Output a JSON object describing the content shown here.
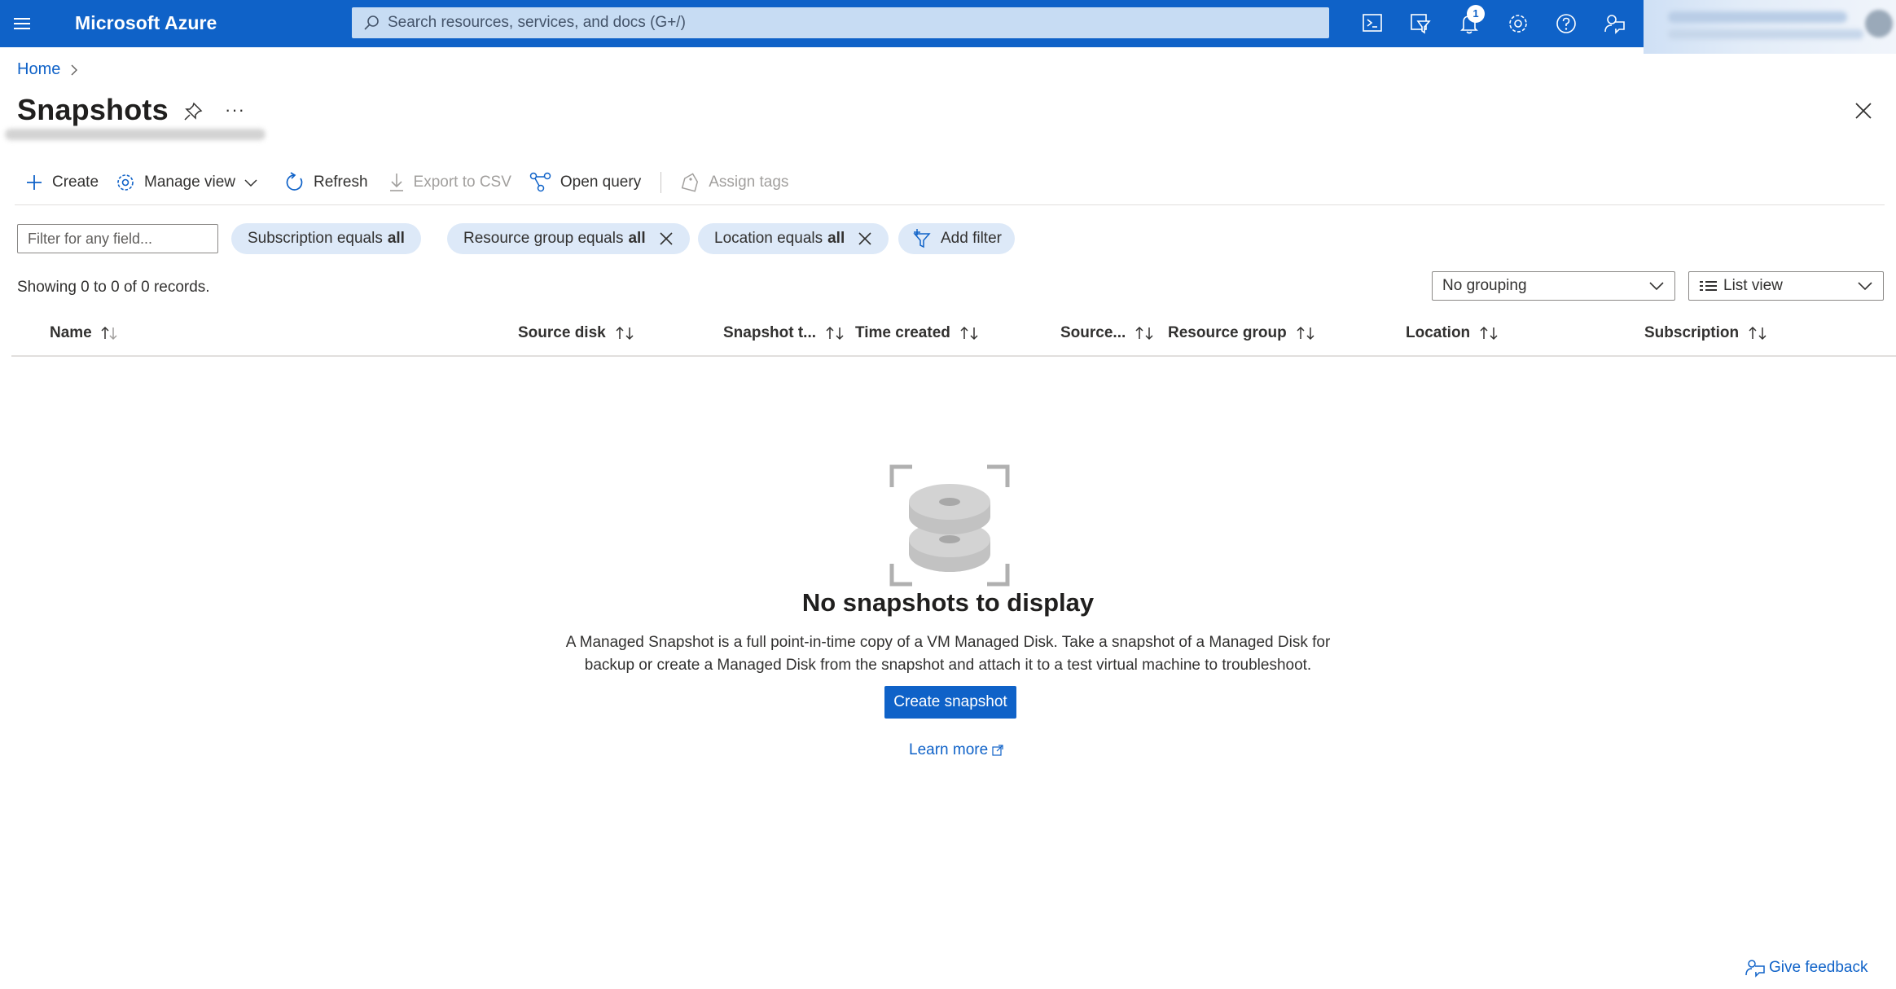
{
  "colors": {
    "brand_blue": "#0f62c8",
    "pill_bg": "#dde9f8",
    "text": "#323130"
  },
  "topbar": {
    "brand": "Microsoft Azure",
    "search_placeholder": "Search resources, services, and docs (G+/)",
    "icons": [
      "menu-icon",
      "cloud-shell-icon",
      "directory-filter-icon",
      "notifications-icon",
      "settings-icon",
      "help-icon",
      "feedback-icon"
    ],
    "notification_count": "1"
  },
  "breadcrumb": {
    "home": "Home"
  },
  "page": {
    "title": "Snapshots",
    "more": "···"
  },
  "toolbar": {
    "create": "Create",
    "manage_view": "Manage view",
    "refresh": "Refresh",
    "export_csv": "Export to CSV",
    "open_query": "Open query",
    "assign_tags": "Assign tags"
  },
  "filters": {
    "placeholder": "Filter for any field...",
    "subscription_prefix": "Subscription equals",
    "subscription_value": "all",
    "resource_group_prefix": "Resource group equals",
    "resource_group_value": "all",
    "location_prefix": "Location equals",
    "location_value": "all",
    "add_filter": "Add filter"
  },
  "records": "Showing 0 to 0 of 0 records.",
  "grouping": {
    "selected": "No grouping"
  },
  "view": {
    "selected": "List view"
  },
  "table": {
    "columns": [
      "Name",
      "Source disk",
      "Snapshot t...",
      "Time created",
      "Source...",
      "Resource group",
      "Location",
      "Subscription"
    ]
  },
  "empty_state": {
    "title": "No snapshots to display",
    "description_line1": "A Managed Snapshot is a full point-in-time copy of a VM Managed Disk. Take a snapshot of a Managed Disk for",
    "description_line2": "backup or create a Managed Disk from the snapshot and attach it to a test virtual machine to troubleshoot.",
    "button": "Create snapshot",
    "learn_more": "Learn more"
  },
  "footer": {
    "feedback": "Give feedback"
  }
}
